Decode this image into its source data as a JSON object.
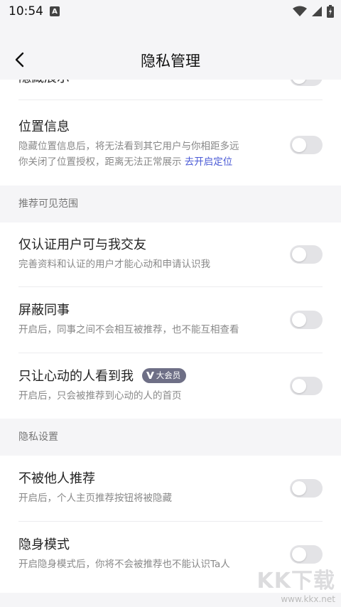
{
  "status_bar": {
    "time": "10:54",
    "notif_letter": "A"
  },
  "header": {
    "title": "隐私管理"
  },
  "rows_top": [
    {
      "label": "隐藏展示",
      "desc": ""
    },
    {
      "label": "位置信息",
      "desc_line1": "隐藏位置信息后，将无法看到其它用户与你相距多远",
      "desc_line2": "你关闭了位置授权，距离无法正常展示 ",
      "link": "去开启定位"
    }
  ],
  "section_recommend": {
    "title": "推荐可见范围",
    "items": [
      {
        "label": "仅认证用户可与我交友",
        "desc": "完善资料和认证的用户才能心动和申请认识我",
        "on": false
      },
      {
        "label": "屏蔽同事",
        "desc": "开启后，同事之间不会相互被推荐，也不能互相查看",
        "on": false
      },
      {
        "label": "只让心动的人看到我",
        "badge": "大会员",
        "desc": "开启后，只会被推荐到心动的人的首页",
        "on": false
      }
    ]
  },
  "section_privacy": {
    "title": "隐私设置",
    "items": [
      {
        "label": "不被他人推荐",
        "desc": "开启后，个人主页推荐按钮将被隐藏",
        "on": false
      },
      {
        "label": "隐身模式",
        "desc": "开启隐身模式后，你将不会被推荐也不能认识Ta人",
        "on": false
      }
    ]
  },
  "watermark": {
    "big": "KK下载",
    "small": "www.kkx.net"
  },
  "colors": {
    "link": "#4b5bd6",
    "toggle_off": "#e3e3e6",
    "badge": "#6e6f86"
  }
}
